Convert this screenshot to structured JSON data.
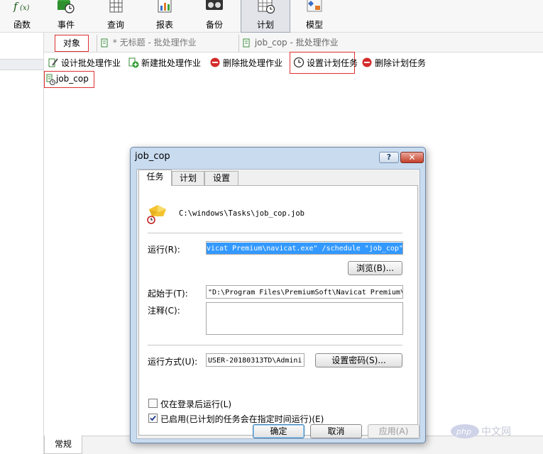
{
  "ribbon": {
    "buttons": [
      {
        "label": "函数",
        "icon": "function-icon"
      },
      {
        "label": "事件",
        "icon": "event-icon"
      },
      {
        "label": "查询",
        "icon": "query-icon"
      },
      {
        "label": "报表",
        "icon": "report-icon"
      },
      {
        "label": "备份",
        "icon": "backup-icon"
      },
      {
        "label": "计划",
        "icon": "schedule-icon",
        "active": true
      },
      {
        "label": "模型",
        "icon": "model-icon"
      }
    ]
  },
  "tabs": {
    "objects": "对象",
    "untitled": "* 无标题 - 批处理作业",
    "jobcop": "job_cop - 批处理作业"
  },
  "toolbar": {
    "design": "设计批处理作业",
    "new": "新建批处理作业",
    "delete": "删除批处理作业",
    "schedule": "设置计划任务",
    "delete_task": "删除计划任务"
  },
  "objects": [
    {
      "name": "job_cop"
    }
  ],
  "bottom_tabs": {
    "general": "常规"
  },
  "dialog": {
    "title": "job_cop",
    "help": "?",
    "close": "✕",
    "tabs": {
      "task": "任务",
      "schedule": "计划",
      "settings": "设置"
    },
    "task_path": "C:\\windows\\Tasks\\job_cop.job",
    "run_label": "运行(R):",
    "run_value": "vicat Premium\\navicat.exe\" /schedule \"job_cop\"",
    "browse_button": "浏览(B)...",
    "start_in_label": "起始于(T):",
    "start_in_value": "\"D:\\Program Files\\PremiumSoft\\Navicat Premium\\",
    "comment_label": "注释(C):",
    "comment_value": "",
    "run_as_label": "运行方式(U):",
    "run_as_value": "USER-20180313TD\\Admini:",
    "set_password_button": "设置密码(S)...",
    "checkbox_logged_on": {
      "label": "仅在登录后运行(L)",
      "checked": false
    },
    "checkbox_enabled": {
      "label": "已启用(已计划的任务会在指定时间运行)(E)",
      "checked": true
    },
    "ok_button": "确定",
    "cancel_button": "取消",
    "apply_button": "应用(A)"
  },
  "watermark": {
    "text": "中文网",
    "badge": "php"
  },
  "colors": {
    "highlight_border": "#e03030",
    "selection": "#3399ff",
    "dialog_frame": "#c9dbef"
  }
}
